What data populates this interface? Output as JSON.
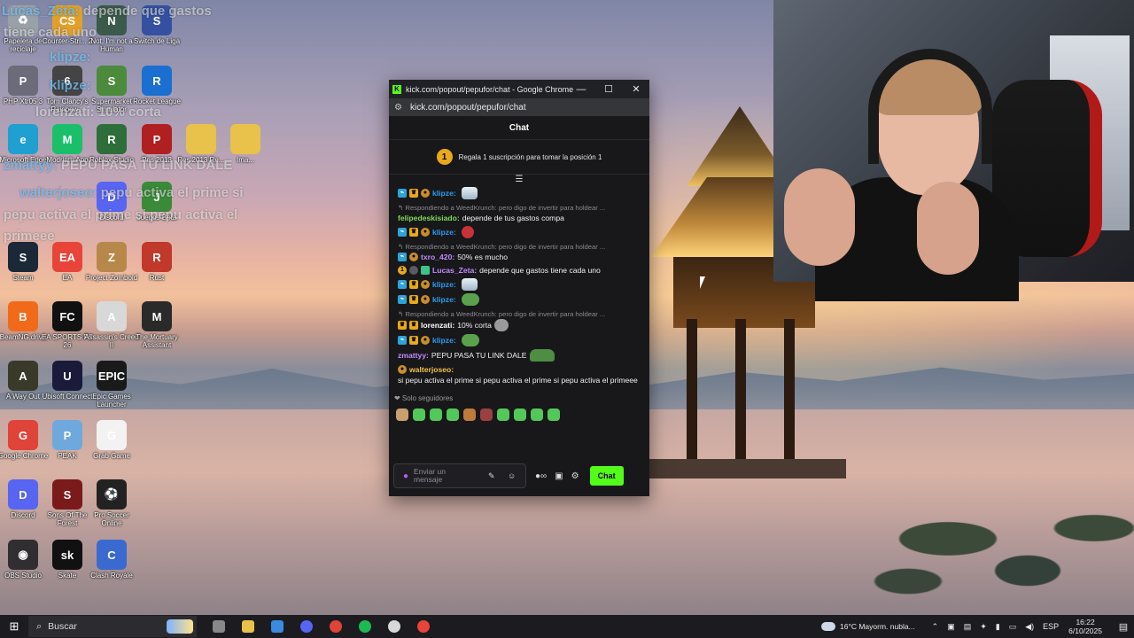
{
  "desktop_icons": [
    {
      "label": "Papelera de reciclaje",
      "name": "recycle-bin-icon",
      "color": "#9aa0a8",
      "glyph": "♻"
    },
    {
      "label": "Counter-Stri... 2",
      "name": "cs2-icon",
      "color": "#e0a02a",
      "glyph": "CS"
    },
    {
      "label": "Not, I'm not a Human",
      "name": "not-human-icon",
      "color": "#3b5a4a",
      "glyph": "N"
    },
    {
      "label": "Switch de Liga",
      "name": "switch-icon",
      "color": "#3550a0",
      "glyph": "S"
    },
    {
      "label": "PHP Xtr05 3",
      "name": "php-icon",
      "color": "#6b6b7a",
      "glyph": "P"
    },
    {
      "label": "Tom Clancy's Rainbow...",
      "name": "rainbow-six-icon",
      "color": "#444",
      "glyph": "6"
    },
    {
      "label": "Supermarket Simulator",
      "name": "supermarket-icon",
      "color": "#4b8b3b",
      "glyph": "S"
    },
    {
      "label": "Rocket League",
      "name": "rocket-league-icon",
      "color": "#1a6fd0",
      "glyph": "R"
    },
    {
      "label": "Microsoft Edge",
      "name": "edge-icon",
      "color": "#1fa0d0",
      "glyph": "e"
    },
    {
      "label": "Modrinth App",
      "name": "modrinth-icon",
      "color": "#1bbf6a",
      "glyph": "M"
    },
    {
      "label": "Roblox Studio",
      "name": "roblox-icon",
      "color": "#2d6e3a",
      "glyph": "R"
    },
    {
      "label": "Pes 2013",
      "name": "pes2013-icon",
      "color": "#b02020",
      "glyph": "P"
    },
    {
      "label": "Pes 2013 Re...",
      "name": "pes2013-folder-icon",
      "color": "#e8c24a",
      "glyph": ""
    },
    {
      "label": "Ima...",
      "name": "folder-icon",
      "color": "#e8c24a",
      "glyph": ""
    },
    {
      "label": "Discord",
      "name": "discord-small-icon",
      "color": "#5865f2",
      "glyph": "D"
    },
    {
      "label": "Juegos Beta",
      "name": "juegos-beta-icon",
      "color": "#3a8a3a",
      "glyph": "J"
    },
    {
      "label": "Steam",
      "name": "steam-icon",
      "color": "#1b2838",
      "glyph": "S"
    },
    {
      "label": "EA",
      "name": "ea-icon",
      "color": "#e8443a",
      "glyph": "EA"
    },
    {
      "label": "Project Zomboid",
      "name": "zomboid-icon",
      "color": "#b7884a",
      "glyph": "Z"
    },
    {
      "label": "Rust",
      "name": "rust-icon",
      "color": "#c0392b",
      "glyph": "R"
    },
    {
      "label": "BeamNG.drive",
      "name": "beamng-icon",
      "color": "#f06a1a",
      "glyph": "B"
    },
    {
      "label": "EA SPORTS FC 26",
      "name": "fc26-icon",
      "color": "#111",
      "glyph": "FC"
    },
    {
      "label": "Assassin's Creed II",
      "name": "assassins-icon",
      "color": "#d8d8d8",
      "glyph": "A"
    },
    {
      "label": "The Mortuary Assistant",
      "name": "mortuary-icon",
      "color": "#2a2a2a",
      "glyph": "M"
    },
    {
      "label": "A Way Out",
      "name": "a-way-out-icon",
      "color": "#3a3a2a",
      "glyph": "A"
    },
    {
      "label": "Ubisoft Connect",
      "name": "ubisoft-icon",
      "color": "#1a1a3a",
      "glyph": "U"
    },
    {
      "label": "Epic Games Launcher",
      "name": "epic-icon",
      "color": "#1a1a1a",
      "glyph": "EPIC"
    },
    {
      "label": "Google Chrome",
      "name": "chrome-desktop-icon",
      "color": "#e0433a",
      "glyph": "G"
    },
    {
      "label": "PEAK",
      "name": "peak-icon",
      "color": "#6fa8dc",
      "glyph": "P"
    },
    {
      "label": "Grab Game",
      "name": "grab-game-icon",
      "color": "#f2f2f2",
      "glyph": "G"
    },
    {
      "label": "Discord",
      "name": "discord-icon",
      "color": "#5865f2",
      "glyph": "D"
    },
    {
      "label": "Sons Of The Forest",
      "name": "sons-forest-icon",
      "color": "#7a1a1a",
      "glyph": "S"
    },
    {
      "label": "Pro Soccer Online",
      "name": "pro-soccer-icon",
      "color": "#222",
      "glyph": "⚽"
    },
    {
      "label": "OBS Studio",
      "name": "obs-icon",
      "color": "#302e31",
      "glyph": "◉"
    },
    {
      "label": "Skate",
      "name": "skate-icon",
      "color": "#111",
      "glyph": "sk"
    },
    {
      "label": "Clash Royale",
      "name": "clash-royale-icon",
      "color": "#3a6ad0",
      "glyph": "C"
    }
  ],
  "overlay": {
    "l1_name": "Lucas_Zeta:",
    "l1_text": "depende que gastos",
    "l1b_text": "tiene cada uno",
    "l2_name": "klipze:",
    "l3_name": "klipze:",
    "l4_text": "lorenzati: 10% corta",
    "l5_name": "zmattyy:",
    "l5_text": "PEPU PASA TU LINK DALE",
    "l6_name": "walterjoseo:",
    "l6_text": "pepu activa el prime si",
    "l6b_text": "pepu activa el prime si pepu activa el",
    "l6c_text": "primeee"
  },
  "window": {
    "title": "kick.com/popout/pepufor/chat - Google Chrome",
    "url": "kick.com/popout/pepufor/chat",
    "minimize": "—",
    "maximize": "☐",
    "close": "✕"
  },
  "chat": {
    "header": "Chat",
    "promo_badge": "1",
    "promo_text": "Regala 1 suscripción para tomar la posición 1",
    "pin_icon": "☰",
    "followers": "❤ Solo seguidores",
    "input_placeholder": "Enviar un mensaje",
    "send_label": "Chat",
    "messages": [
      {
        "reply": "",
        "user": "klipze",
        "color": "#2d9bf0",
        "text": "",
        "badges": "bot,crown,coin",
        "emote": "ice"
      },
      {
        "reply": "↰ Respondiendo a WeedKrunch: pero digo de invertir para holdear ...",
        "user": "felipedeskisiado",
        "color": "#7ed957",
        "text": "depende de tus gastos compa",
        "badges": "",
        "emote": ""
      },
      {
        "reply": "",
        "user": "klipze",
        "color": "#2d9bf0",
        "text": "",
        "badges": "bot,crown,coin",
        "emote": "red"
      },
      {
        "reply": "↰ Respondiendo a WeedKrunch: pero digo de invertir para holdear ...",
        "user": "txro_420",
        "color": "#c38cff",
        "text": "50% es mucho",
        "badges": "bot,coin",
        "emote": ""
      },
      {
        "reply": "",
        "user": "Lucas_Zeta",
        "color": "#c38cff",
        "text": "depende que gastos tiene cada uno",
        "badges": "one,gray,green",
        "emote": ""
      },
      {
        "reply": "",
        "user": "klipze",
        "color": "#2d9bf0",
        "text": "",
        "badges": "bot,crown,coin",
        "emote": "ice"
      },
      {
        "reply": "",
        "user": "klipze",
        "color": "#2d9bf0",
        "text": "",
        "badges": "bot,crown,coin",
        "emote": "frog"
      },
      {
        "reply": "↰ Respondiendo a WeedKrunch: pero digo de invertir para holdear ...",
        "user": "lorenzati",
        "color": "#ffffff",
        "text": "10% corta",
        "badges": "crown,crown",
        "emote": "gray"
      },
      {
        "reply": "",
        "user": "klipze",
        "color": "#2d9bf0",
        "text": "",
        "badges": "bot,crown,coin",
        "emote": "frog"
      },
      {
        "reply": "",
        "user": "zmattyy",
        "color": "#c38cff",
        "text": "PEPU PASA TU LINK DALE",
        "badges": "",
        "emote": "frog2"
      },
      {
        "reply": "",
        "user": "walterjoseo",
        "color": "#f0c24a",
        "text": "si pepu activa el prime si pepu activa el prime si pepu activa el primeee",
        "badges": "coin",
        "emote": ""
      }
    ]
  },
  "taskbar": {
    "search_placeholder": "Buscar",
    "weather": "16°C  Mayorm. nubla...",
    "lang": "ESP",
    "time": "16:22",
    "date": "6/10/2025",
    "apps": [
      {
        "name": "task-view-icon",
        "color": "#888"
      },
      {
        "name": "file-explorer-icon",
        "color": "#e8c24a"
      },
      {
        "name": "store-icon",
        "color": "#3a8ae0"
      },
      {
        "name": "discord-taskbar-icon",
        "color": "#5865f2"
      },
      {
        "name": "chrome-taskbar-icon",
        "color": "#e0433a"
      },
      {
        "name": "spotify-icon",
        "color": "#1db954"
      },
      {
        "name": "obs-taskbar-icon",
        "color": "#d8d8d8"
      },
      {
        "name": "app-taskbar-icon",
        "color": "#e8443a"
      }
    ]
  }
}
